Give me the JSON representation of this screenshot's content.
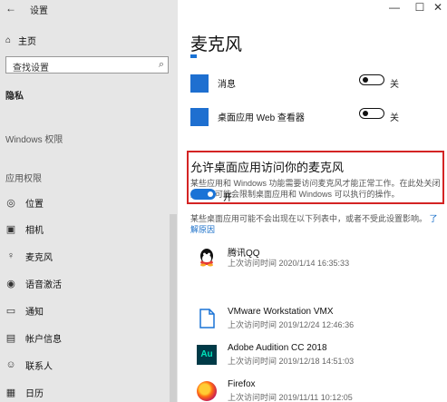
{
  "window": {
    "back_icon": "back-arrow-icon",
    "title": "设置",
    "minimize": "—",
    "maximize": "☐",
    "close": "✕"
  },
  "sidebar": {
    "home": {
      "icon": "home-icon",
      "label": "主页"
    },
    "search_placeholder": "查找设置",
    "privacy_label": "隐私",
    "windows_permissions": "Windows 权限",
    "app_permissions": "应用权限",
    "items": [
      {
        "icon": "location-icon",
        "label": "位置"
      },
      {
        "icon": "camera-icon",
        "label": "相机"
      },
      {
        "icon": "microphone-icon",
        "label": "麦克风"
      },
      {
        "icon": "voice-activation-icon",
        "label": "语音激活"
      },
      {
        "icon": "notification-icon",
        "label": "通知"
      },
      {
        "icon": "account-info-icon",
        "label": "帐户信息"
      },
      {
        "icon": "contacts-icon",
        "label": "联系人"
      },
      {
        "icon": "calendar-icon",
        "label": "日历"
      }
    ]
  },
  "main": {
    "title": "麦克风",
    "store_apps": [
      {
        "name": "消息",
        "state": "关",
        "color": "#1e6fd0"
      },
      {
        "name": "桌面应用 Web 查看器",
        "state": "关",
        "color": "#1e6fd0"
      }
    ],
    "permission": {
      "title": "允许桌面应用访问你的麦克风",
      "description": "某些应用和 Windows 功能需要访问麦克风才能正常工作。在此处关闭此设置可能会限制桌面应用和 Windows 可以执行的操作。",
      "toggle_label": "开",
      "toggle_on": true,
      "accent": "#1a73d6",
      "highlight_color": "#d42424"
    },
    "note_text": "某些桌面应用可能不会出现在以下列表中，或者不受此设置影响。",
    "note_link": "了解原因",
    "desktop_apps": [
      {
        "name": "腾讯QQ",
        "time": "上次访问时间 2020/1/14 16:35:33",
        "icon": "qq-icon"
      },
      {
        "name": "VMware Workstation VMX",
        "time": "上次访问时间 2019/12/24 12:46:36",
        "icon": "vmware-file-icon"
      },
      {
        "name": "Adobe Audition CC 2018",
        "time": "上次访问时间 2019/12/18 14:51:03",
        "icon": "adobe-audition-icon",
        "icon_text": "Au"
      },
      {
        "name": "Firefox",
        "time": "上次访问时间 2019/11/11 10:12:05",
        "icon": "firefox-icon"
      }
    ]
  }
}
